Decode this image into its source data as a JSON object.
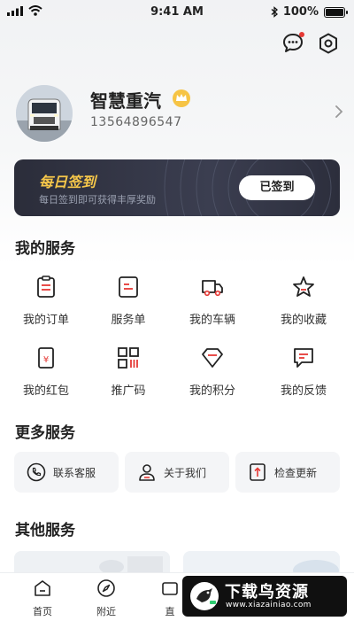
{
  "status_bar": {
    "time": "9:41 AM",
    "battery": "100%"
  },
  "profile": {
    "name": "智慧重汽",
    "phone": "13564896547"
  },
  "checkin": {
    "title": "每日签到",
    "subtitle": "每日签到即可获得丰厚奖励",
    "button": "已签到"
  },
  "my_services": {
    "title": "我的服务",
    "items": [
      {
        "label": "我的订单",
        "icon": "order-icon"
      },
      {
        "label": "服务单",
        "icon": "service-ticket-icon"
      },
      {
        "label": "我的车辆",
        "icon": "truck-icon"
      },
      {
        "label": "我的收藏",
        "icon": "star-icon"
      },
      {
        "label": "我的红包",
        "icon": "red-packet-icon"
      },
      {
        "label": "推广码",
        "icon": "qr-code-icon"
      },
      {
        "label": "我的积分",
        "icon": "diamond-icon"
      },
      {
        "label": "我的反馈",
        "icon": "feedback-icon"
      }
    ]
  },
  "more_services": {
    "title": "更多服务",
    "items": [
      {
        "label": "联系客服",
        "icon": "phone-icon"
      },
      {
        "label": "关于我们",
        "icon": "user-icon"
      },
      {
        "label": "检查更新",
        "icon": "update-icon"
      }
    ]
  },
  "other_services": {
    "title": "其他服务"
  },
  "tab_bar": {
    "items": [
      {
        "label": "首页",
        "icon": "home-icon"
      },
      {
        "label": "附近",
        "icon": "compass-icon"
      },
      {
        "label": "直",
        "icon": "live-icon"
      }
    ]
  },
  "watermark": {
    "title": "下载鸟资源",
    "url": "www.xiazainiao.com"
  }
}
